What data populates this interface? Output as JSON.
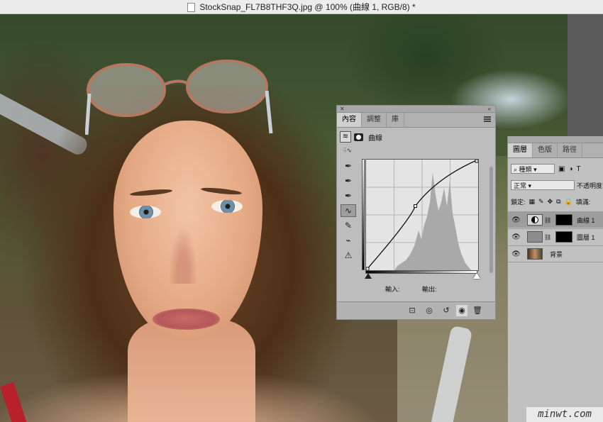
{
  "window": {
    "title": "StockSnap_FL7B8THF3Q.jpg @ 100% (曲線 1, RGB/8) *"
  },
  "properties": {
    "tabs": [
      "內容",
      "調整",
      "庫"
    ],
    "header_label": "曲線",
    "input_label": "輸入:",
    "output_label": "輸出:",
    "curve_points": [
      [
        0,
        0
      ],
      [
        0.44,
        0.58
      ],
      [
        1,
        1
      ]
    ]
  },
  "layers": {
    "tabs": [
      "圖層",
      "色版",
      "路徑"
    ],
    "filter_kind": "種類",
    "blend_mode": "正常",
    "opacity_label": "不透明度:",
    "lock_label": "鎖定:",
    "fill_label": "填滿:",
    "items": [
      {
        "name": "曲線 1",
        "selected": true
      },
      {
        "name": "圖層 1",
        "selected": false
      },
      {
        "name": "背景",
        "selected": false
      }
    ]
  },
  "watermark": "minwt.com"
}
